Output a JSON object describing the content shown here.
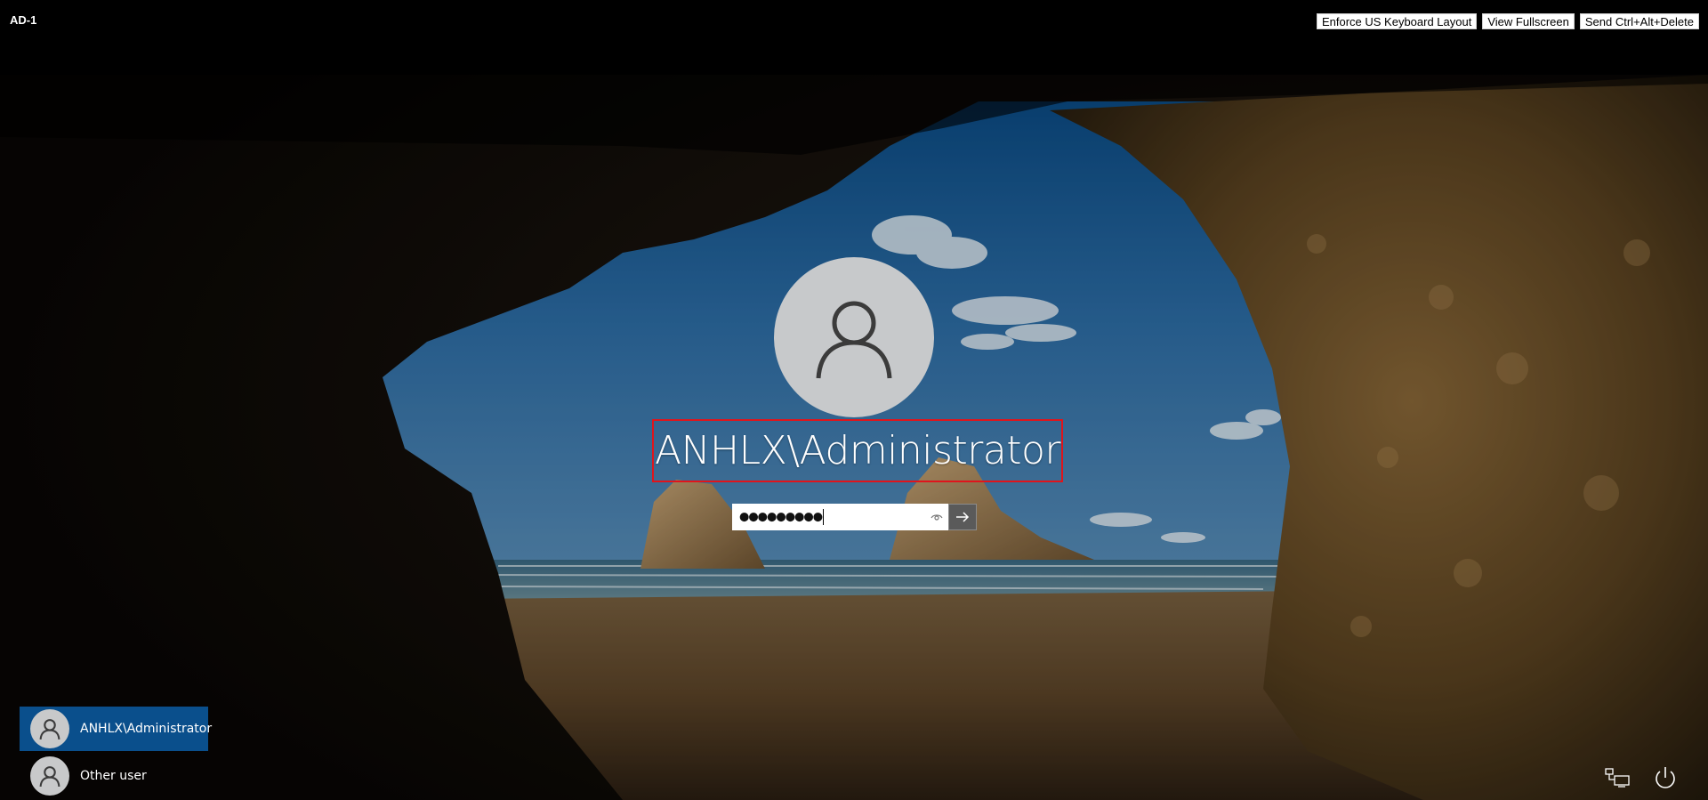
{
  "window": {
    "title": "AD-1"
  },
  "console_buttons": [
    {
      "label": "Enforce US Keyboard Layout"
    },
    {
      "label": "View Fullscreen"
    },
    {
      "label": "Send Ctrl+Alt+Delete"
    }
  ],
  "login": {
    "username": "ANHLX\\Administrator",
    "password_masked": "●●●●●●●●●"
  },
  "users": [
    {
      "name": "ANHLX\\Administrator",
      "selected": true
    },
    {
      "name": "Other user",
      "selected": false
    }
  ],
  "icons": {
    "avatar": "user-silhouette-icon",
    "reveal": "eye-icon",
    "submit": "arrow-right-icon",
    "network": "network-icon",
    "accessibility": "ease-of-access-icon",
    "power": "power-icon"
  },
  "colors": {
    "selected_user": "#0a4f8c",
    "highlight_border": "#e0141b",
    "avatar": "#c7c9cb"
  }
}
